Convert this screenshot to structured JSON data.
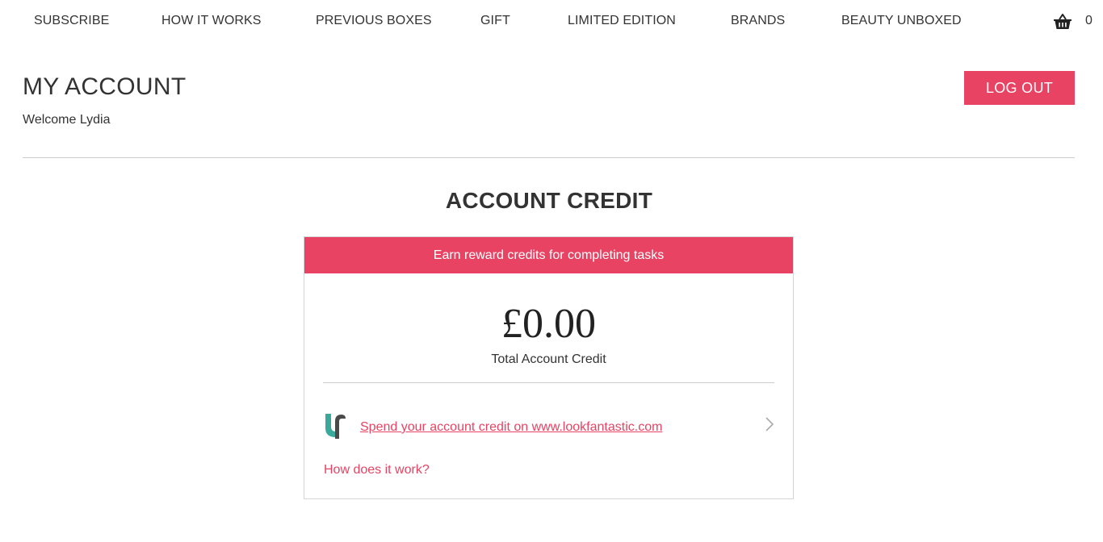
{
  "nav": {
    "items": [
      {
        "label": "SUBSCRIBE"
      },
      {
        "label": "HOW IT WORKS"
      },
      {
        "label": "PREVIOUS BOXES"
      },
      {
        "label": "GIFT"
      },
      {
        "label": "LIMITED EDITION"
      },
      {
        "label": "BRANDS"
      },
      {
        "label": "BEAUTY UNBOXED"
      }
    ],
    "basket_icon": "basket-icon",
    "basket_count": "0"
  },
  "header": {
    "title": "MY ACCOUNT",
    "welcome": "Welcome Lydia",
    "logout_label": "LOG OUT"
  },
  "account_credit": {
    "section_title": "ACCOUNT CREDIT",
    "banner": "Earn reward credits for completing tasks",
    "amount": "£0.00",
    "amount_label": "Total Account Credit",
    "spend_link": "Spend your account credit on www.lookfantastic.com",
    "spend_icon": "lookfantastic-logo-icon",
    "chevron_icon": "chevron-right-icon",
    "how_link": "How does it work?"
  },
  "colors": {
    "accent": "#e84363",
    "text": "#333333",
    "divider": "#cccccc",
    "logo_teal": "#3aa89a",
    "logo_dark": "#4a4a4a"
  }
}
